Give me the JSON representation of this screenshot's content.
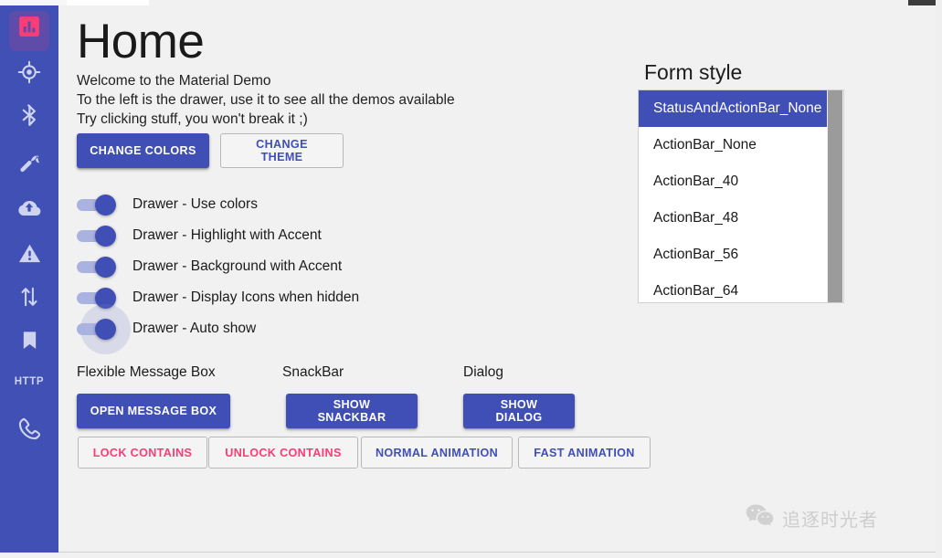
{
  "window": {
    "title": "Home"
  },
  "theme": {
    "drawer_bg": "#4050b5",
    "drawer_active_bg": "#5e4ca8",
    "accent_pink": "#fb3c76",
    "primary_indigo": "#3f4fb5",
    "content_bg": "#f1f1f1",
    "icon_tint": "#ced4f0"
  },
  "drawer": {
    "items": [
      {
        "icon": "bar-chart-icon",
        "active": true,
        "label": ""
      },
      {
        "icon": "gps-target-icon",
        "active": false,
        "label": ""
      },
      {
        "icon": "bluetooth-icon",
        "active": false,
        "label": ""
      },
      {
        "icon": "wrench-icon",
        "active": false,
        "label": ""
      },
      {
        "icon": "cloud-upload-icon",
        "active": false,
        "label": ""
      },
      {
        "icon": "warning-triangle-icon",
        "active": false,
        "label": ""
      },
      {
        "icon": "transfer-arrows-icon",
        "active": false,
        "label": ""
      },
      {
        "icon": "bookmark-icon",
        "active": false,
        "label": ""
      },
      {
        "icon": "http-text-icon",
        "active": false,
        "label": "HTTP"
      },
      {
        "icon": "phone-icon",
        "active": false,
        "label": ""
      }
    ]
  },
  "main": {
    "title": "Home",
    "welcome_text": "Welcome to the Material Demo\nTo the left is the drawer, use it to see all the demos available\nTry clicking stuff, you won't break it ;)",
    "change_colors_label": "CHANGE COLORS",
    "change_theme_label": "CHANGE THEME",
    "switches": [
      {
        "label": "Drawer - Use colors",
        "on": true,
        "rippled": false
      },
      {
        "label": "Drawer - Highlight with Accent",
        "on": true,
        "rippled": false
      },
      {
        "label": "Drawer - Background with Accent",
        "on": true,
        "rippled": false
      },
      {
        "label": "Drawer - Display Icons when hidden",
        "on": true,
        "rippled": false
      },
      {
        "label": "Drawer - Auto show",
        "on": true,
        "rippled": true
      }
    ],
    "form_style": {
      "title": "Form style",
      "selected": "StatusAndActionBar_None",
      "options": [
        "StatusAndActionBar_None",
        "ActionBar_None",
        "ActionBar_40",
        "ActionBar_48",
        "ActionBar_56",
        "ActionBar_64"
      ]
    },
    "sections": {
      "flexible_message_box_label": "Flexible Message Box",
      "snackbar_label": "SnackBar",
      "dialog_label": "Dialog"
    },
    "action_buttons": {
      "open_message_box": "OPEN MESSAGE BOX",
      "show_snackbar": "SHOW SNACKBAR",
      "show_dialog": "SHOW DIALOG",
      "lock_contains": "LOCK CONTAINS",
      "unlock_contains": "UNLOCK CONTAINS",
      "normal_animation": "NORMAL ANIMATION",
      "fast_animation": "FAST ANIMATION"
    }
  },
  "watermark": {
    "icon": "wechat-icon",
    "text": "追逐时光者"
  }
}
